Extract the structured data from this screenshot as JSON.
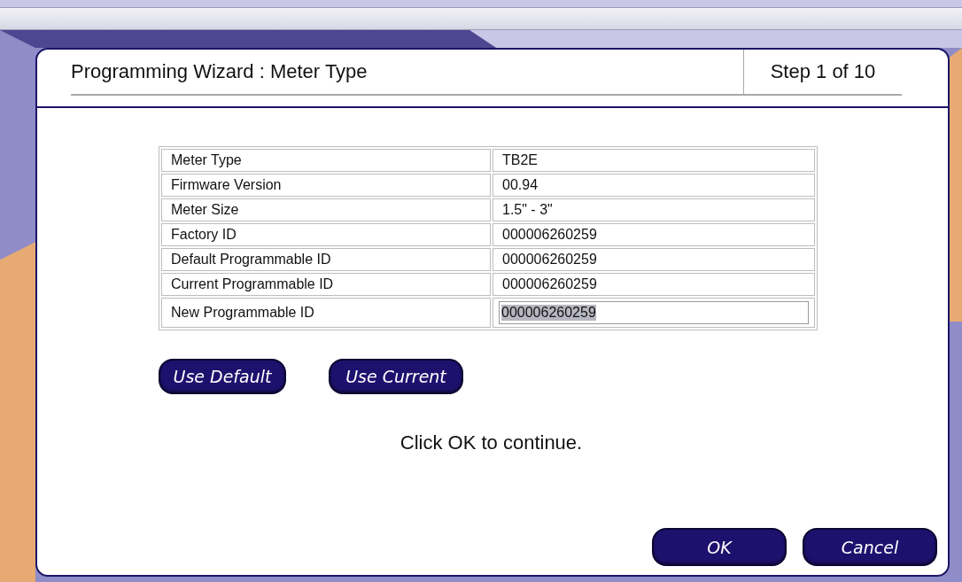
{
  "dialog": {
    "title": "Programming Wizard : Meter Type",
    "step": "Step 1 of 10"
  },
  "table": {
    "rows": [
      {
        "kind": "text",
        "label": "Meter Type",
        "value": "TB2E"
      },
      {
        "kind": "text",
        "label": "Firmware Version",
        "value": "00.94"
      },
      {
        "kind": "text",
        "label": "Meter Size",
        "value": "1.5\" - 3\""
      },
      {
        "kind": "text",
        "label": "Factory ID",
        "value": "000006260259"
      },
      {
        "kind": "text",
        "label": "Default Programmable ID",
        "value": "000006260259"
      },
      {
        "kind": "text",
        "label": "Current Programmable ID",
        "value": "000006260259"
      },
      {
        "kind": "input",
        "label": "New Programmable ID",
        "value": "000006260259",
        "highlighted": true
      }
    ]
  },
  "id_buttons": [
    "Use Default",
    "Use Current"
  ],
  "message": "Click OK to continue.",
  "buttons": [
    "OK",
    "Cancel"
  ]
}
